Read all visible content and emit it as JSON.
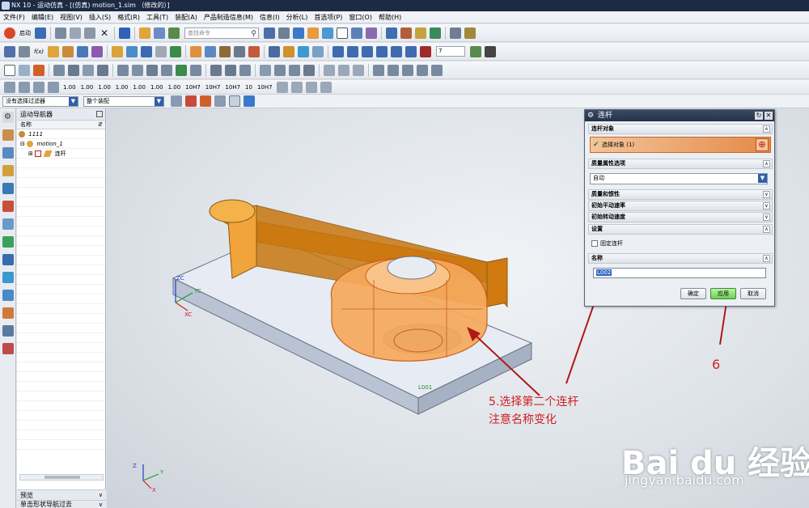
{
  "window": {
    "title": "NX 10 - 运动仿真 - [(仿真) motion_1.sim （修改的）]"
  },
  "menubar": [
    "文件(F)",
    "编辑(E)",
    "视图(V)",
    "插入(S)",
    "格式(R)",
    "工具(T)",
    "装配(A)",
    "产品制造信息(M)",
    "信息(I)",
    "分析(L)",
    "首选项(P)",
    "窗口(O)",
    "帮助(H)"
  ],
  "toolbar": {
    "start_label": "启动",
    "find_placeholder": "查找命令",
    "spin_value": "7",
    "num_buttons": [
      "1.00",
      "1.00",
      "1.00",
      "1.00",
      "1.00",
      "1.00",
      "1.00",
      "10H7",
      "10H7",
      "10H7",
      "10",
      "10H7"
    ]
  },
  "filterbar": {
    "selection_filter": "没有选择过滤器",
    "assembly_scope": "整个装配"
  },
  "navigator": {
    "title": "运动导航器",
    "column_header": "名称",
    "tree": [
      {
        "label": "1111"
      },
      {
        "label": "motion_1"
      },
      {
        "label": "连杆"
      }
    ],
    "bottom_sections": [
      "预览",
      "单击形状导航过去"
    ]
  },
  "graphics": {
    "label_link": "L001",
    "axes": {
      "zc": "ZC",
      "yc": "YC",
      "xc": "XC",
      "z": "Z",
      "y": "Y",
      "x": "X"
    }
  },
  "dialog": {
    "title": "连杆",
    "sections": {
      "link_object": "连杆对象",
      "select_object": "选择对象 (1)",
      "mass_properties": "质量属性选项",
      "mass_value": "自动",
      "mass_inertia": "质量和惯性",
      "init_velocity": "初始平动速率",
      "init_rot_velocity": "初始转动速度",
      "settings": "设置",
      "fixed_link": "固定连杆",
      "name": "名称",
      "name_value": "L002"
    },
    "buttons": {
      "ok": "确定",
      "apply": "应用",
      "cancel": "取消"
    }
  },
  "annotations": {
    "step5_line1": "5.选择第二个连杆",
    "step5_line2": "注意名称变化",
    "step6": "6"
  },
  "watermark": {
    "brand": "Bai du 经验",
    "url": "jingyan.baidu.com"
  },
  "colors": {
    "part_orange": "#f5a623",
    "annotation_red": "#d02020",
    "dialog_title": "#24324a",
    "apply_green": "#6ccf57"
  }
}
